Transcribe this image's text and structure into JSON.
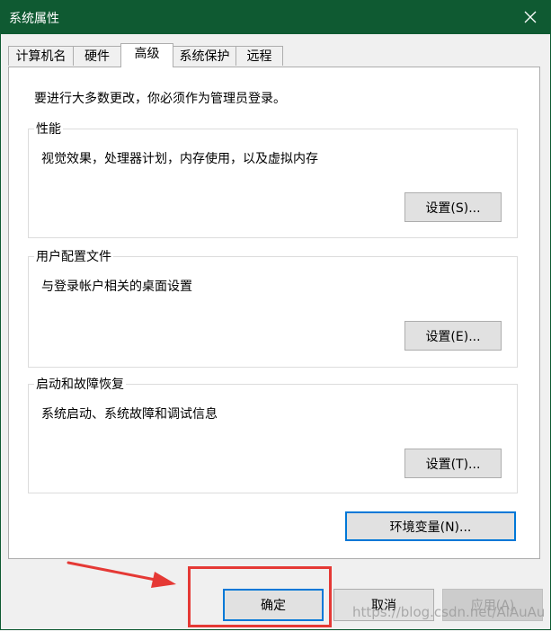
{
  "window": {
    "title": "系统属性"
  },
  "tabs": [
    {
      "label": "计算机名"
    },
    {
      "label": "硬件"
    },
    {
      "label": "高级"
    },
    {
      "label": "系统保护"
    },
    {
      "label": "远程"
    }
  ],
  "notice": "要进行大多数更改，你必须作为管理员登录。",
  "groups": {
    "performance": {
      "title": "性能",
      "desc": "视觉效果，处理器计划，内存使用，以及虚拟内存",
      "button": "设置(S)..."
    },
    "profiles": {
      "title": "用户配置文件",
      "desc": "与登录帐户相关的桌面设置",
      "button": "设置(E)..."
    },
    "startup": {
      "title": "启动和故障恢复",
      "desc": "系统启动、系统故障和调试信息",
      "button": "设置(T)..."
    }
  },
  "env_button": "环境变量(N)...",
  "footer": {
    "ok": "确定",
    "cancel": "取消",
    "apply": "应用(A)"
  },
  "watermark": "https://blog.csdn.net/AlAuAu",
  "colors": {
    "titlebar": "#0f5a32",
    "focus": "#0078d7",
    "annotation": "#e53935"
  }
}
